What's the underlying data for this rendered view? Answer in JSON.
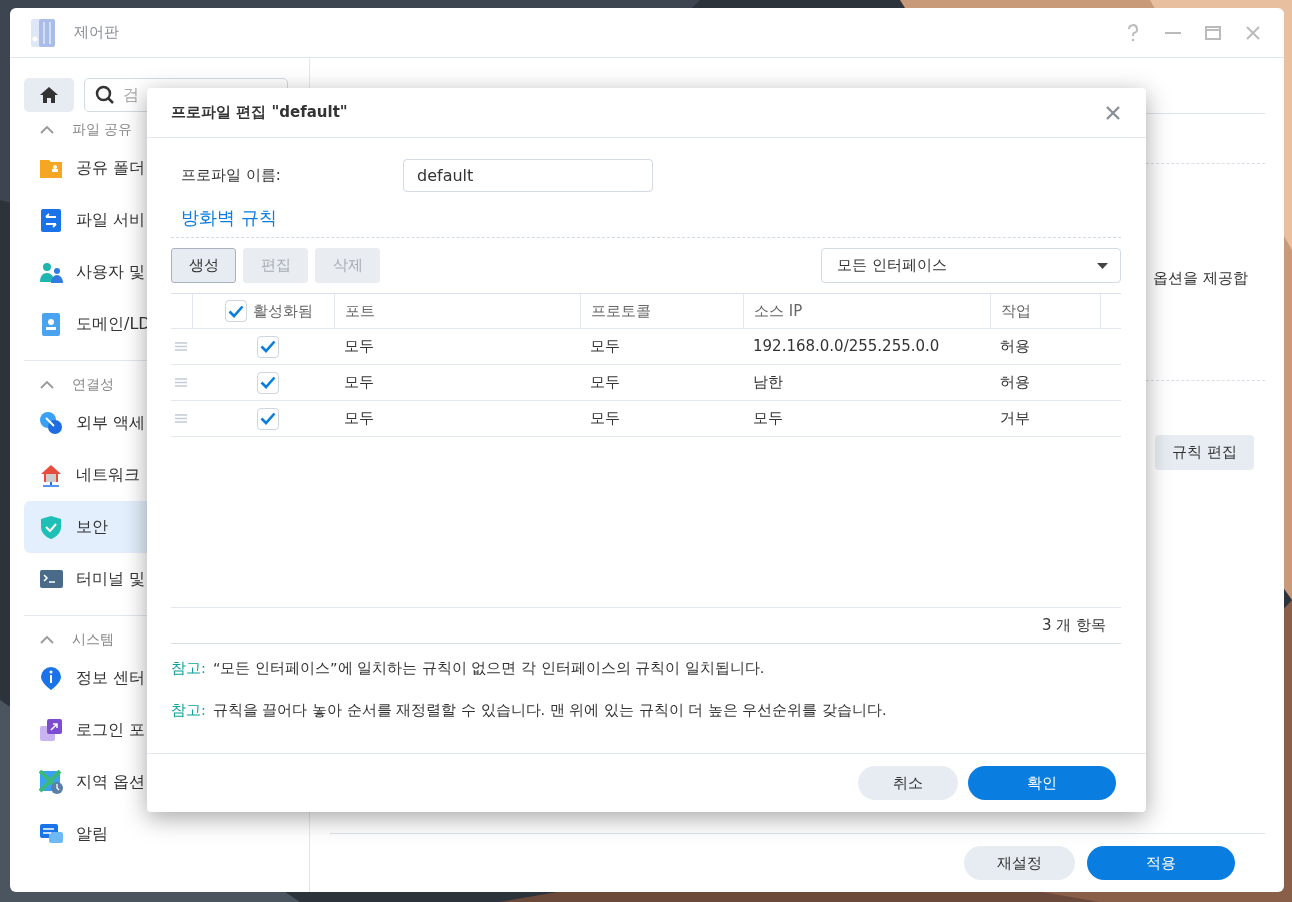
{
  "window": {
    "title": "제어판"
  },
  "sidebar": {
    "search": {
      "placeholder": "검"
    },
    "sections": [
      {
        "title": "파일 공유",
        "expanded": true,
        "items": [
          {
            "label": "공유 폴더",
            "selected": false
          },
          {
            "label": "파일 서비",
            "selected": false
          },
          {
            "label": "사용자 및",
            "selected": false
          },
          {
            "label": "도메인/LD",
            "selected": false
          }
        ]
      },
      {
        "title": "연결성",
        "expanded": true,
        "items": [
          {
            "label": "외부 액세",
            "selected": false
          },
          {
            "label": "네트워크",
            "selected": false
          },
          {
            "label": "보안",
            "selected": true
          },
          {
            "label": "터미널 및",
            "selected": false
          }
        ]
      },
      {
        "title": "시스템",
        "expanded": true,
        "items": [
          {
            "label": "정보 센터",
            "selected": false
          },
          {
            "label": "로그인 포",
            "selected": false
          },
          {
            "label": "지역 옵션",
            "selected": false
          },
          {
            "label": "알림",
            "selected": false
          }
        ]
      }
    ]
  },
  "content": {
    "description": "옵션을 제공합",
    "edit_rules_button": "규칙 편집",
    "buttons": [
      {
        "label": "재설정",
        "primary": false
      },
      {
        "label": "적용",
        "primary": true
      }
    ]
  },
  "dialog": {
    "title": "프로파일 편집 \"default\"",
    "profile_name": {
      "label": "프로파일 이름:",
      "value": "default"
    },
    "section_title": "방화벽 규칙",
    "toolbar": [
      {
        "label": "생성",
        "disabled": false
      },
      {
        "label": "편집",
        "disabled": true
      },
      {
        "label": "삭제",
        "disabled": true
      }
    ],
    "interface_select": {
      "value": "모든 인터페이스"
    },
    "table": {
      "columns": [
        {
          "label": "활성화됨",
          "checkbox": true,
          "checked": true
        },
        {
          "label": "포트"
        },
        {
          "label": "프로토콜"
        },
        {
          "label": "소스 IP"
        },
        {
          "label": "작업"
        }
      ],
      "rows": [
        {
          "cells": [
            {
              "kind": "checkbox",
              "checked": true
            },
            {
              "kind": "text",
              "text": "모두"
            },
            {
              "kind": "text",
              "text": "모두"
            },
            {
              "kind": "text",
              "text": "192.168.0.0/255.255.0.0"
            },
            {
              "kind": "text",
              "text": "허용"
            }
          ]
        },
        {
          "cells": [
            {
              "kind": "checkbox",
              "checked": true
            },
            {
              "kind": "text",
              "text": "모두"
            },
            {
              "kind": "text",
              "text": "모두"
            },
            {
              "kind": "text",
              "text": "남한"
            },
            {
              "kind": "text",
              "text": "허용"
            }
          ]
        },
        {
          "cells": [
            {
              "kind": "checkbox",
              "checked": true
            },
            {
              "kind": "text",
              "text": "모두"
            },
            {
              "kind": "text",
              "text": "모두"
            },
            {
              "kind": "text",
              "text": "모두"
            },
            {
              "kind": "text",
              "text": "거부"
            }
          ]
        }
      ],
      "count": "3 개 항목"
    },
    "notes": [
      {
        "label": "참고:",
        "text": "“모든 인터페이스”에 일치하는 규칙이 없으면 각 인터페이스의 규칙이 일치됩니다."
      },
      {
        "label": "참고:",
        "text": "규칙을 끌어다 놓아 순서를 재정렬할 수 있습니다. 맨 위에 있는 규칙이 더 높은 우선순위를 갖습니다."
      }
    ],
    "buttons": [
      {
        "label": "취소",
        "primary": false
      },
      {
        "label": "확인",
        "primary": true
      }
    ]
  }
}
